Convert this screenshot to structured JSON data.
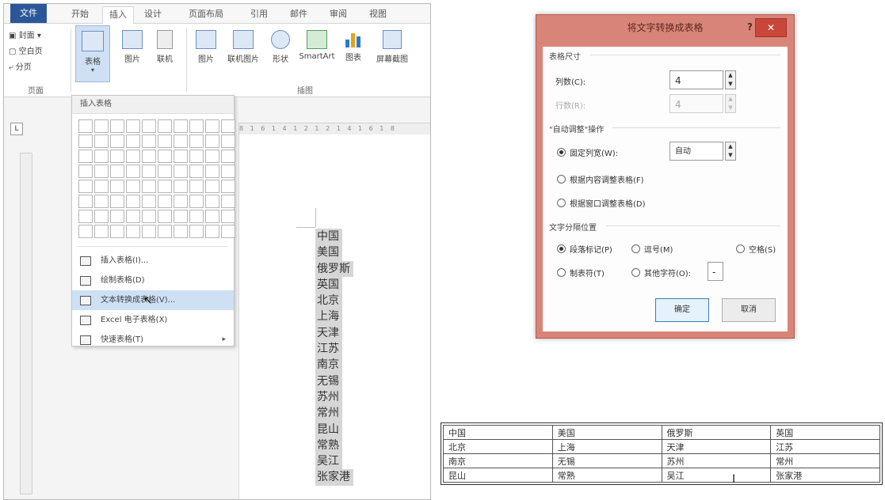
{
  "word": {
    "tabs": [
      "文件",
      "开始",
      "插入",
      "设计",
      "页面布局",
      "引用",
      "邮件",
      "审阅",
      "视图"
    ],
    "active_tab_index": 2,
    "ribbon": {
      "pages_group": [
        "封面",
        "空白页",
        "分页"
      ],
      "pages_group_label": "页面",
      "table_button": "表格",
      "picture_button": "图片",
      "online_button": "联机",
      "picture2_button": "图片",
      "online_picture_button": "联机图片",
      "shapes_button": "形状",
      "smartart_button": "SmartArt",
      "chart_button": "图表",
      "screenshot_button": "屏幕截图",
      "illustrations_label": "插图"
    },
    "insert_table_menu": {
      "header": "插入表格",
      "grid_cols": 10,
      "grid_rows": 8,
      "items": [
        {
          "label": "插入表格(I)...",
          "icon": "insert-table-icon",
          "hover": false
        },
        {
          "label": "绘制表格(D)",
          "icon": "draw-table-icon",
          "hover": false
        },
        {
          "label": "文本转换成表格(V)...",
          "icon": "text-to-table-icon",
          "hover": true
        },
        {
          "label": "Excel 电子表格(X)",
          "icon": "excel-sheet-icon",
          "hover": false
        },
        {
          "label": "快速表格(T)",
          "icon": "quick-table-icon",
          "hover": false
        }
      ]
    },
    "ruler_corner": "L",
    "ruler_h": "8 1 6 1 4 1 2 1 2 1 4 1 6 1 8",
    "document_lines": [
      "中国",
      "美国",
      "俄罗斯",
      "英国",
      "北京",
      "上海",
      "天津",
      "江苏",
      "南京",
      "无锡",
      "苏州",
      "常州",
      "昆山",
      "常熟",
      "吴江",
      "张家港"
    ]
  },
  "dialog": {
    "title": "将文字转换成表格",
    "help": "?",
    "close": "✕",
    "table_size_label": "表格尺寸",
    "columns_label": "列数(C):",
    "columns_value": "4",
    "rows_label": "行数(R):",
    "rows_value": "4",
    "autofit_label": "\"自动调整\"操作",
    "fixed_width_label": "固定列宽(W):",
    "fixed_width_value": "自动",
    "fit_content_label": "根据内容调整表格(F)",
    "fit_window_label": "根据窗口调整表格(D)",
    "separator_label": "文字分隔位置",
    "sep_paragraph": "段落标记(P)",
    "sep_comma": "逗号(M)",
    "sep_space": "空格(S)",
    "sep_tab": "制表符(T)",
    "sep_other": "其他字符(O):",
    "sep_other_value": "-",
    "ok": "确定",
    "cancel": "取消",
    "accent": "#d98478"
  },
  "result_table": {
    "rows": [
      [
        "中国",
        "美国",
        "俄罗斯",
        "英国"
      ],
      [
        "北京",
        "上海",
        "天津",
        "江苏"
      ],
      [
        "南京",
        "无锡",
        "苏州",
        "常州"
      ],
      [
        "昆山",
        "常熟",
        "吴江",
        "张家港"
      ]
    ]
  }
}
